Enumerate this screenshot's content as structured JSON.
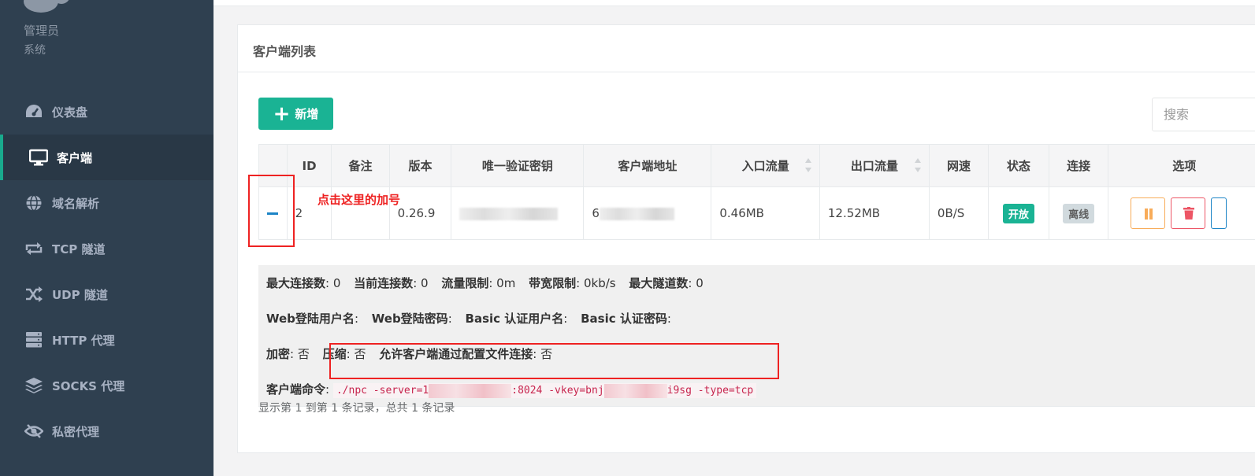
{
  "profile": {
    "name": "管理员",
    "role": "系统"
  },
  "nav": [
    {
      "label": "仪表盘",
      "icon": "dashboard-icon"
    },
    {
      "label": "客户端",
      "icon": "monitor-icon",
      "active": true
    },
    {
      "label": "域名解析",
      "icon": "globe-icon"
    },
    {
      "label": "TCP 隧道",
      "icon": "exchange-icon"
    },
    {
      "label": "UDP 隧道",
      "icon": "shuffle-icon"
    },
    {
      "label": "HTTP 代理",
      "icon": "server-icon"
    },
    {
      "label": "SOCKS 代理",
      "icon": "layers-icon"
    },
    {
      "label": "私密代理",
      "icon": "eye-slash-icon"
    }
  ],
  "panel": {
    "title": "客户端列表"
  },
  "toolbar": {
    "add_label": "新增",
    "search_placeholder": "搜索"
  },
  "table": {
    "headers": [
      "",
      "ID",
      "备注",
      "版本",
      "唯一验证密钥",
      "客户端地址",
      "入口流量",
      "出口流量",
      "网速",
      "状态",
      "连接",
      "选项"
    ],
    "row": {
      "id": "2",
      "remark": "",
      "version": "0.26.9",
      "vkey": "",
      "address": "6",
      "inlet_flow": "0.46MB",
      "export_flow": "12.52MB",
      "rate": "0B/S",
      "status": "开放",
      "connection": "离线"
    }
  },
  "detail": {
    "line1": {
      "max_conn_label": "最大连接数",
      "max_conn_value": ": 0",
      "cur_conn_label": "当前连接数",
      "cur_conn_value": ": 0",
      "flow_limit_label": "流量限制",
      "flow_limit_value": ": 0m",
      "bw_limit_label": "带宽限制",
      "bw_limit_value": ": 0kb/s",
      "max_tunnel_label": "最大隧道数",
      "max_tunnel_value": ": 0"
    },
    "line2": {
      "web_user_label": "Web登陆用户名",
      "web_pass_label": "Web登陆密码",
      "basic_user_label": "Basic 认证用户名",
      "basic_pass_label": "Basic 认证密码"
    },
    "line3": {
      "crypt_label": "加密",
      "crypt_value": ": 否",
      "compress_label": "压缩",
      "compress_value": ": 否",
      "config_conn_label": "允许客户端通过配置文件连接",
      "config_conn_value": ": 否"
    },
    "cmd_label": "客户端命令",
    "cmd_part1": "./npc -server=1",
    "cmd_part2": ":8024 -vkey=bnj",
    "cmd_part3": "i9sg -type=tcp"
  },
  "footer": {
    "summary": "显示第 1 到第 1 条记录，总共 1 条记录"
  },
  "annotation": {
    "text": "点击这里的加号"
  },
  "colors": {
    "sidebar": "#2f4050",
    "accent": "#1ab394",
    "annotation": "#ee2222"
  }
}
